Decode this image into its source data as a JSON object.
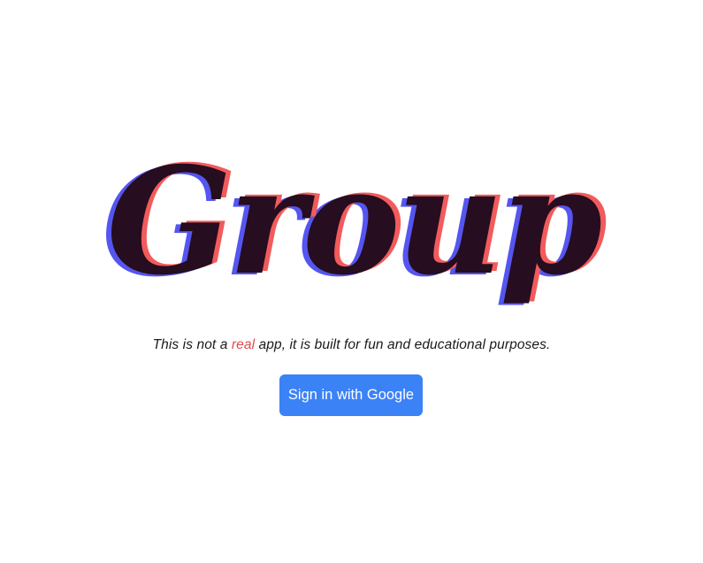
{
  "logo": {
    "text": "Group",
    "colors": {
      "fill": "#260d1f",
      "shadow_red": "#f25b5b",
      "shadow_blue": "#5555f0"
    }
  },
  "tagline": {
    "before": "This is not a ",
    "highlight": "real",
    "after": " app, it is built for fun and educational purposes."
  },
  "signin": {
    "label": "Sign in with Google",
    "color": "#3b82f6"
  }
}
